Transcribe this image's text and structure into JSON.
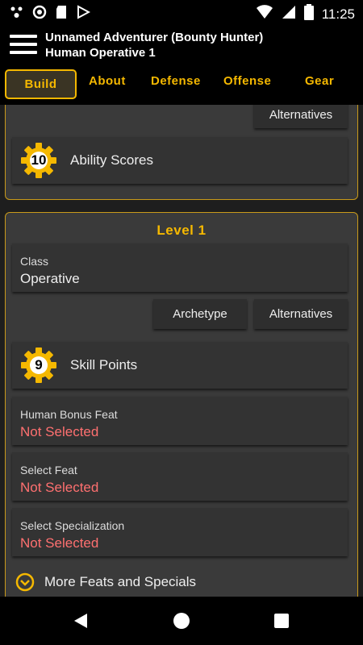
{
  "status_bar": {
    "time": "11:25",
    "left_icons": [
      "sparkle-icon",
      "circle-icon",
      "sd-card-icon",
      "play-store-icon"
    ],
    "right_icons": [
      "wifi-icon",
      "signal-icon",
      "battery-icon"
    ]
  },
  "app_bar": {
    "title_line1": "Unnamed Adventurer (Bounty Hunter)",
    "title_line2": "Human Operative 1"
  },
  "tabs": [
    {
      "label": "Build",
      "active": true
    },
    {
      "label": "About",
      "active": false
    },
    {
      "label": "Defense",
      "active": false
    },
    {
      "label": "Offense",
      "active": false
    },
    {
      "label": "Gear",
      "active": false
    }
  ],
  "top_panel": {
    "alternatives_label": "Alternatives",
    "ability_scores": {
      "count": "10",
      "label": "Ability Scores"
    }
  },
  "level_panel": {
    "title": "Level 1",
    "class": {
      "label": "Class",
      "value": "Operative"
    },
    "archetype_label": "Archetype",
    "alternatives_label": "Alternatives",
    "skill_points": {
      "count": "9",
      "label": "Skill Points"
    },
    "selections": [
      {
        "label": "Human Bonus Feat",
        "value": "Not Selected"
      },
      {
        "label": "Select Feat",
        "value": "Not Selected"
      },
      {
        "label": "Select Specialization",
        "value": "Not Selected"
      }
    ],
    "more_label": "More Feats and Specials"
  },
  "colors": {
    "accent": "#f5b800",
    "warning": "#ff7070",
    "panel": "#3a3a3a",
    "card": "#333333"
  }
}
